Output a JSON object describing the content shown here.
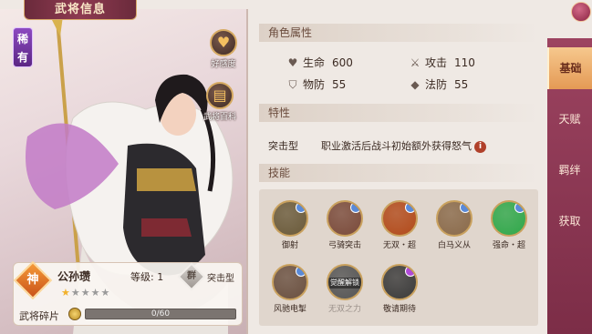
{
  "window": {
    "title": "武将信息"
  },
  "hero": {
    "rarity": "稀有",
    "faction": "神",
    "name": "公孙瓒",
    "level_label": "等级: 1",
    "type_badge": "群",
    "type_label": "突击型",
    "stars_total": 5,
    "stars_filled": 1,
    "fragments_label": "武将碎片",
    "fragments_text": "0/60",
    "fragments_progress": 0
  },
  "side_buttons": [
    {
      "label": "好感度",
      "icon": "heart-icon"
    },
    {
      "label": "武将百科",
      "icon": "book-icon"
    }
  ],
  "attributes": {
    "header": "角色属性",
    "items": [
      {
        "label": "生命",
        "value": "600",
        "icon": "heart-icon"
      },
      {
        "label": "攻击",
        "value": "110",
        "icon": "sword-icon"
      },
      {
        "label": "物防",
        "value": "55",
        "icon": "shield-icon"
      },
      {
        "label": "法防",
        "value": "55",
        "icon": "magic-shield-icon"
      }
    ]
  },
  "traits": {
    "header": "特性",
    "label": "突击型",
    "description": "职业激活后战斗初始额外获得怒气"
  },
  "skills": {
    "header": "技能",
    "items": [
      {
        "name": "御射",
        "color": "#6a5a3a",
        "locked": false
      },
      {
        "name": "弓骑突击",
        "color": "#7a4a3a",
        "locked": false
      },
      {
        "name": "无双・超",
        "color": "#b24a1a",
        "locked": false
      },
      {
        "name": "白马义从",
        "color": "#8a6a4a",
        "locked": false
      },
      {
        "name": "强命・超",
        "color": "#2fa84a",
        "locked": false
      },
      {
        "name": "风驰电掣",
        "color": "#6a5040",
        "locked": false
      },
      {
        "name": "无双之力",
        "color": "#555555",
        "locked": true,
        "overlay": "觉醒解锁"
      },
      {
        "name": "敬请期待",
        "color": "#3a3a3a",
        "locked": false
      }
    ]
  },
  "tabs": [
    {
      "label": "基础",
      "active": true
    },
    {
      "label": "天赋",
      "active": false
    },
    {
      "label": "羁绊",
      "active": false
    },
    {
      "label": "获取",
      "active": false
    }
  ]
}
